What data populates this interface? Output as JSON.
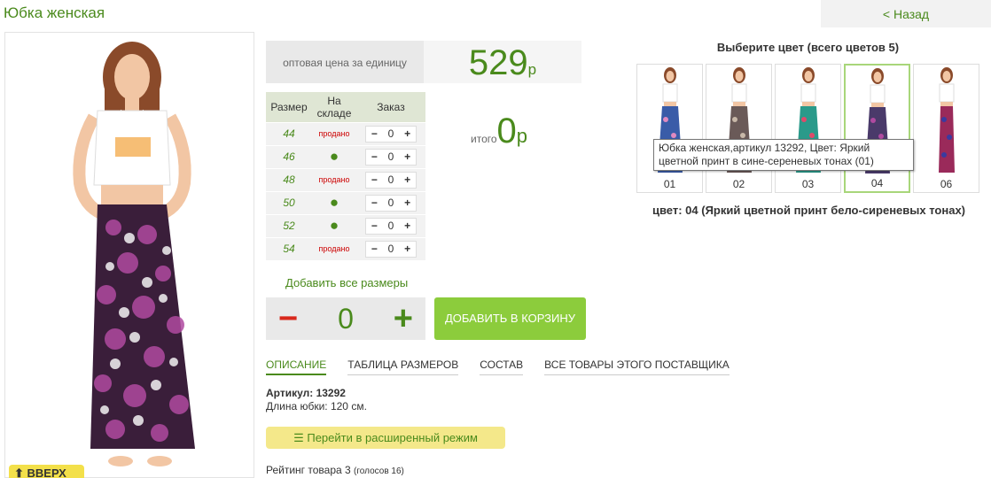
{
  "title": "Юбка женская",
  "back_label": "< Назад",
  "up_label": "⬆ ВВЕРХ",
  "price": {
    "label": "оптовая цена за единицу",
    "value": "529",
    "currency": "р"
  },
  "size_table": {
    "headers": [
      "Размер",
      "На складе",
      "Заказ"
    ],
    "rows": [
      {
        "size": "44",
        "stock": "продано",
        "qty": "0"
      },
      {
        "size": "46",
        "stock": "●",
        "qty": "0"
      },
      {
        "size": "48",
        "stock": "продано",
        "qty": "0"
      },
      {
        "size": "50",
        "stock": "●",
        "qty": "0"
      },
      {
        "size": "52",
        "stock": "●",
        "qty": "0"
      },
      {
        "size": "54",
        "stock": "продано",
        "qty": "0"
      }
    ],
    "minus": "−",
    "plus": "+"
  },
  "total": {
    "label": "итого",
    "value": "0",
    "currency": "р"
  },
  "add_all_label": "Добавить все размеры",
  "big_qty": {
    "minus": "−",
    "value": "0",
    "plus": "+"
  },
  "cart_label": "ДОБАВИТЬ В КОРЗИНУ",
  "tabs": [
    "ОПИСАНИЕ",
    "ТАБЛИЦА РАЗМЕРОВ",
    "СОСТАВ",
    "ВСЕ ТОВАРЫ ЭТОГО ПОСТАВЩИКА"
  ],
  "description": {
    "article_label": "Артикул: 13292",
    "length": "Длина юбки: 120 см."
  },
  "expand_label": "☰ Перейти в расширенный режим",
  "rating": {
    "text": "Рейтинг товара 3",
    "votes": "(голосов 16)"
  },
  "colors": {
    "title": "Выберите цвет (всего цветов 5)",
    "items": [
      {
        "label": "01",
        "skirt": "#3a5ca8"
      },
      {
        "label": "02",
        "skirt": "#6a5a58"
      },
      {
        "label": "03",
        "skirt": "#2a9a8a"
      },
      {
        "label": "04",
        "skirt": "#4a3a6a"
      },
      {
        "label": "06",
        "skirt": "#9a2a5a"
      }
    ],
    "tooltip": "Юбка женская,артикул 13292, Цвет: Яркий цветной принт в сине-сереневых тонах (01)",
    "selected_text": "цвет: 04 (Яркий цветной принт бело-сиреневых тонах)"
  },
  "accent": "#4a8a1c"
}
